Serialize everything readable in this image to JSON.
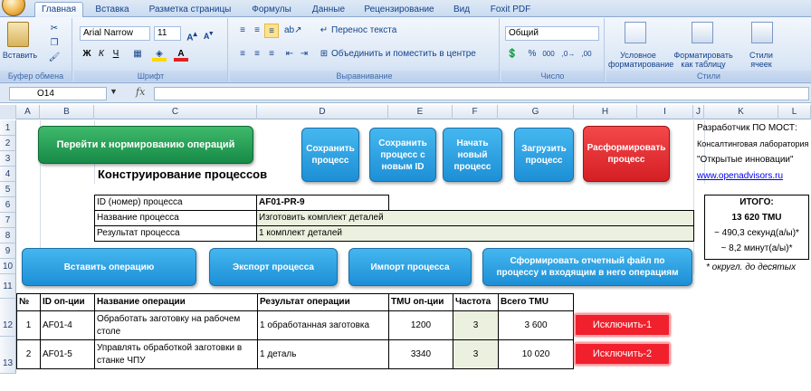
{
  "ribbon": {
    "tabs": [
      "Главная",
      "Вставка",
      "Разметка страницы",
      "Формулы",
      "Данные",
      "Рецензирование",
      "Вид",
      "Foxit PDF"
    ],
    "clipboard": {
      "paste": "Вставить",
      "label": "Буфер обмена"
    },
    "font": {
      "name": "Arial Narrow",
      "size": "11",
      "label": "Шрифт"
    },
    "alignment": {
      "wrap": "Перенос текста",
      "merge": "Объединить и поместить в центре",
      "label": "Выравнивание"
    },
    "number": {
      "format": "Общий",
      "label": "Число"
    },
    "styles": {
      "conditional": "Условное форматирование",
      "as_table": "Форматировать как таблицу",
      "cell_styles": "Стили ячеек",
      "label": "Стили"
    }
  },
  "formula_bar": {
    "name_box": "O14",
    "fx": "fx",
    "value": ""
  },
  "columns": [
    "A",
    "B",
    "C",
    "D",
    "E",
    "F",
    "G",
    "H",
    "I",
    "J",
    "K",
    "L"
  ],
  "rows": [
    "1",
    "2",
    "3",
    "4",
    "5",
    "6",
    "7",
    "8",
    "9",
    "10",
    "11",
    "12",
    "13"
  ],
  "buttons": {
    "goto_norm": "Перейти к нормированию операций",
    "save": "Сохранить процесс",
    "save_new": "Сохранить процесс с новым ID",
    "start_new": "Начать новый процесс",
    "load": "Загрузить процесс",
    "disband": "Расформировать процесс",
    "insert_op": "Вставить операцию",
    "export": "Экспорт процесса",
    "import": "Импорт процесса",
    "report": "Сформировать отчетный файл по процессу и входящим в него операциям",
    "exclude": [
      "Исключить-1",
      "Исключить-2"
    ]
  },
  "sheet": {
    "title": "Конструирование процессов",
    "id_label": "ID (номер) процесса",
    "id_value": "AF01-PR-9",
    "name_label": "Название процесса",
    "name_value": "Изготовить комплект деталей",
    "result_label": "Результат процесса",
    "result_value": "1 комплект деталей",
    "dev_title": "Разработчик ПО МОСТ:",
    "dev_line1": "Консалтинговая лаборатория",
    "dev_line2": "\"Открытые инновации\"",
    "dev_link": "www.openadvisors.ru",
    "total_label": "ИТОГО:",
    "total_tmu": "13 620  TMU",
    "total_sec": "~ 490,3 секунд(а/ы)*",
    "total_min": "~ 8,2 минут(а/ы)*",
    "footnote": "* округл. до десятых"
  },
  "table": {
    "headers": [
      "№",
      "ID оп-ции",
      "Название операции",
      "Результат операции",
      "TMU оп-ции",
      "Частота",
      "Всего TMU"
    ],
    "rows": [
      {
        "n": "1",
        "id": "AF01-4",
        "name": "Обработать заготовку на рабочем столе",
        "result": "1 обработанная заготовка",
        "tmu": "1200",
        "freq": "3",
        "total": "3 600"
      },
      {
        "n": "2",
        "id": "AF01-5",
        "name": "Управлять обработкой заготовки в станке ЧПУ",
        "result": "1 деталь",
        "tmu": "3340",
        "freq": "3",
        "total": "10 020"
      }
    ]
  }
}
